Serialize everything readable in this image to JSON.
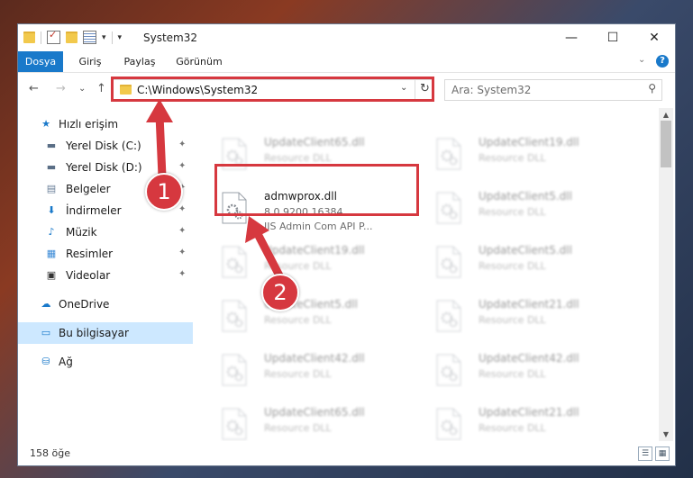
{
  "window": {
    "title": "System32",
    "controls": {
      "minimize": "—",
      "maximize": "☐",
      "close": "✕"
    }
  },
  "ribbon": {
    "tabs": [
      "Dosya",
      "Giriş",
      "Paylaş",
      "Görünüm"
    ],
    "collapse": "⌄",
    "help": "?"
  },
  "nav": {
    "back": "←",
    "forward": "→",
    "recent": "⌄",
    "up": "↑",
    "address": "C:\\Windows\\System32",
    "address_dropdown": "⌄",
    "refresh": "↻",
    "search_placeholder": "Ara: System32",
    "search_icon": "⚲"
  },
  "sidebar": {
    "items": [
      {
        "label": "Hızlı erişim",
        "icon": "star-icon",
        "glyph": "★",
        "color": "#1979ca",
        "pinned": false
      },
      {
        "label": "Yerel Disk (C:)",
        "icon": "drive-icon",
        "glyph": "▬",
        "color": "#5a6e86",
        "pinned": true
      },
      {
        "label": "Yerel Disk (D:)",
        "icon": "drive-icon",
        "glyph": "▬",
        "color": "#5a6e86",
        "pinned": true
      },
      {
        "label": "Belgeler",
        "icon": "documents-icon",
        "glyph": "▤",
        "color": "#6a7f99",
        "pinned": true
      },
      {
        "label": "İndirmeler",
        "icon": "download-icon",
        "glyph": "⬇",
        "color": "#1979ca",
        "pinned": true
      },
      {
        "label": "Müzik",
        "icon": "music-icon",
        "glyph": "♪",
        "color": "#1979ca",
        "pinned": true
      },
      {
        "label": "Resimler",
        "icon": "pictures-icon",
        "glyph": "▦",
        "color": "#3a8ad6",
        "pinned": true
      },
      {
        "label": "Videolar",
        "icon": "video-icon",
        "glyph": "▣",
        "color": "#333333",
        "pinned": true
      },
      {
        "label": "OneDrive",
        "icon": "cloud-icon",
        "glyph": "☁",
        "color": "#1979ca",
        "pinned": false
      },
      {
        "label": "Bu bilgisayar",
        "icon": "computer-icon",
        "glyph": "▭",
        "color": "#1979ca",
        "pinned": false
      },
      {
        "label": "Ağ",
        "icon": "network-icon",
        "glyph": "⛁",
        "color": "#1979ca",
        "pinned": false
      }
    ],
    "pin_glyph": "📌"
  },
  "files": [
    {
      "name": "UpdateClient65.dll",
      "line2": "Resource DLL",
      "line3": "",
      "highlight": false
    },
    {
      "name": "UpdateClient19.dll",
      "line2": "Resource DLL",
      "line3": "",
      "highlight": false
    },
    {
      "name": "admwprox.dll",
      "line2": "8.0.9200.16384",
      "line3": "IIS Admin Com API P...",
      "highlight": true
    },
    {
      "name": "UpdateClient5.dll",
      "line2": "Resource DLL",
      "line3": "",
      "highlight": false
    },
    {
      "name": "UpdateClient19.dll",
      "line2": "Resource DLL",
      "line3": "",
      "highlight": false
    },
    {
      "name": "UpdateClient5.dll",
      "line2": "Resource DLL",
      "line3": "",
      "highlight": false
    },
    {
      "name": "UpdateClient5.dll",
      "line2": "Resource DLL",
      "line3": "",
      "highlight": false
    },
    {
      "name": "UpdateClient21.dll",
      "line2": "Resource DLL",
      "line3": "",
      "highlight": false
    },
    {
      "name": "UpdateClient42.dll",
      "line2": "Resource DLL",
      "line3": "",
      "highlight": false
    },
    {
      "name": "UpdateClient42.dll",
      "line2": "Resource DLL",
      "line3": "",
      "highlight": false
    },
    {
      "name": "UpdateClient65.dll",
      "line2": "Resource DLL",
      "line3": "",
      "highlight": false
    },
    {
      "name": "UpdateClient21.dll",
      "line2": "Resource DLL",
      "line3": "",
      "highlight": false
    }
  ],
  "status": {
    "count": "158 öğe"
  },
  "annotations": {
    "callout1": "1",
    "callout2": "2",
    "accent": "#d6383f"
  }
}
